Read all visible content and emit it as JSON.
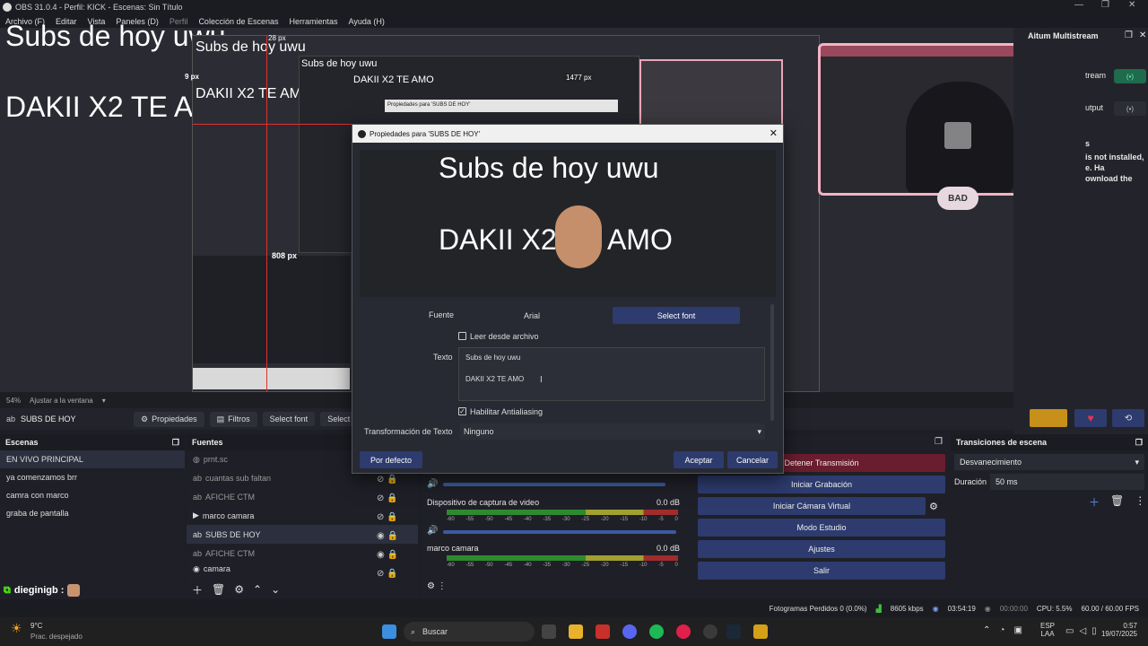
{
  "titlebar": {
    "title": "OBS 31.0.4 - Perfil: KICK - Escenas: Sin Título"
  },
  "menu": [
    "Archivo (F)",
    "Editar",
    "Vista",
    "Paneles (D)",
    "Perfil",
    "Colección de Escenas",
    "Herramientas",
    "Ayuda (H)"
  ],
  "preview": {
    "line1": "Subs de hoy uwu",
    "line2": "DAKII X2 TE AMO",
    "px_top": "28 px",
    "px_left": "9 px",
    "px_mid": "1477 px",
    "px_bottom": "808 px",
    "nested_label": "Propiedades para 'SUBS DE HOY'"
  },
  "multistream": {
    "title": "Aitum Multistream",
    "row1": "tream",
    "row2": "utput",
    "note1": "s",
    "note2": "is not installed,",
    "note3": "e. Ha",
    "note4": "ownload the"
  },
  "status": {
    "zoom": "54%",
    "fit": "Ajustar a la ventana"
  },
  "source_toolbar": {
    "source_name": "SUBS DE HOY",
    "properties": "Propiedades",
    "filters": "Filtros",
    "select_font": "Select font",
    "select_cut": "Select c"
  },
  "scenes": {
    "title": "Escenas",
    "items": [
      "EN VIVO PRINCIPAL",
      "ya comenzamos brr",
      "camra con marco",
      "graba de pantalla"
    ]
  },
  "sources": {
    "title": "Fuentes",
    "items": [
      "prnt.sc",
      "cuantas sub faltan",
      "AFICHE CTM",
      "marco camara",
      "SUBS DE HOY",
      "AFICHE CTM",
      "camara"
    ]
  },
  "mixer": {
    "ch1": "Dispositivo de captura de video",
    "ch1_db": "0.0 dB",
    "ch2": "marco camara",
    "ch2_db": "0.0 dB",
    "ticks": [
      "-60",
      "-55",
      "-50",
      "-45",
      "-40",
      "-35",
      "-30",
      "-25",
      "-20",
      "-15",
      "-10",
      "-5",
      "0"
    ]
  },
  "controls": {
    "stop_stream": "Detener Transmisión",
    "start_rec": "Iniciar Grabación",
    "virtual_cam": "Iniciar Cámara Virtual",
    "studio": "Modo Estudio",
    "settings": "Ajustes",
    "exit": "Salir"
  },
  "transitions": {
    "title": "Transiciones de escena",
    "type": "Desvanecimiento",
    "duration_label": "Duración",
    "duration": "50 ms"
  },
  "chat": {
    "user": "dieginigb :"
  },
  "footer": {
    "dropped": "Fotogramas Perdidos 0 (0.0%)",
    "bitrate": "8605 kbps",
    "live": "03:54:19",
    "rec": "00:00:00",
    "cpu": "CPU: 5.5%",
    "fps": "60.00 / 60.00 FPS"
  },
  "taskbar": {
    "temp": "9°C",
    "weather": "Prac. despejado",
    "search": "Buscar",
    "lang1": "ESP",
    "lang2": "LAA",
    "time": "0:57",
    "date": "19/07/2025"
  },
  "dialog": {
    "title": "Propiedades para 'SUBS DE HOY'",
    "font_label": "Fuente",
    "font_value": "Arial",
    "select_font": "Select font",
    "read_file": "Leer desde archivo",
    "text_label": "Texto",
    "text_line1": "Subs de hoy uwu",
    "text_line2": "DAKII X2 TE AMO",
    "antialias": "Habilitar Antialiasing",
    "transform_label": "Transformación de Texto",
    "transform_value": "Ninguno",
    "default_btn": "Por defecto",
    "accept_btn": "Aceptar",
    "cancel_btn": "Cancelar"
  }
}
